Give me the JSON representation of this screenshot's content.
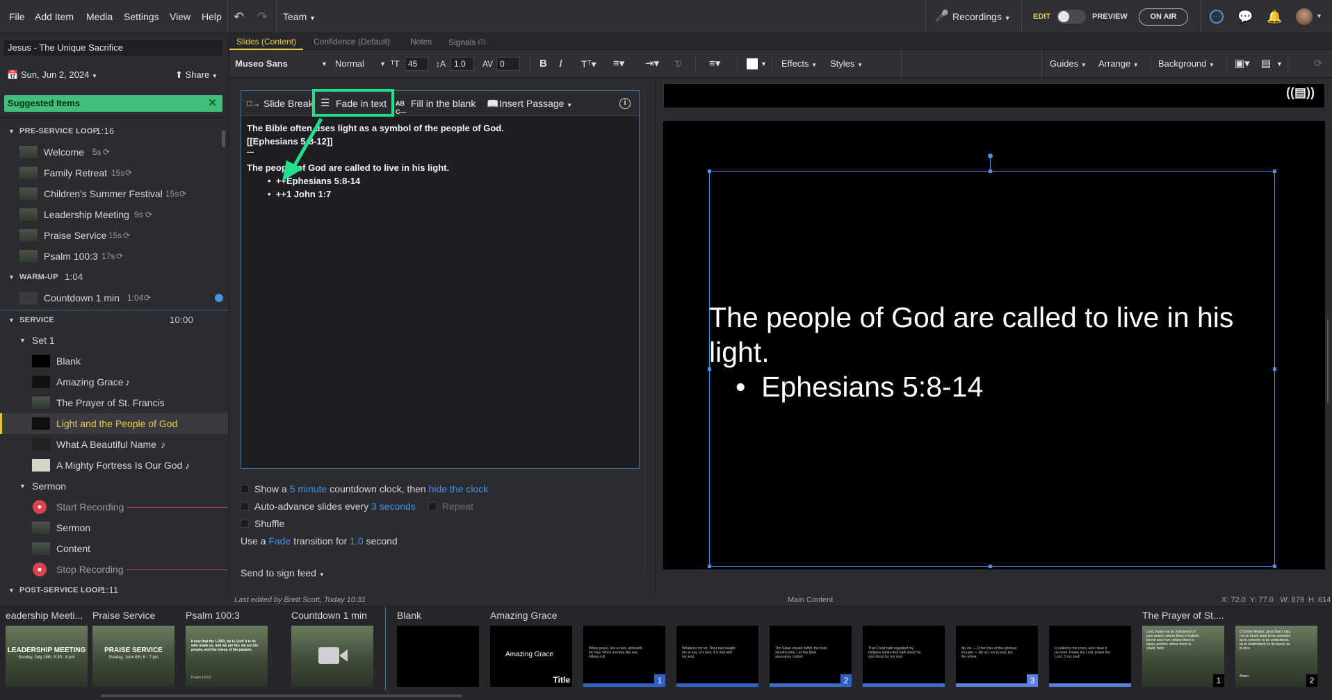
{
  "menubar": {
    "items": [
      "File",
      "Add Item",
      "Media",
      "Settings",
      "View",
      "Help"
    ],
    "team_label": "Team",
    "recordings_label": "Recordings",
    "edit_label": "EDIT",
    "preview_label": "PREVIEW",
    "on_air_label": "ON AIR"
  },
  "plan": {
    "title": "Jesus - The Unique Sacrifice",
    "date": "Sun, Jun 2, 2024",
    "share_label": "Share",
    "suggested_label": "Suggested Items"
  },
  "sidebar": {
    "pre_service": {
      "label": "PRE-SERVICE LOOP",
      "duration": "1:16",
      "items": [
        {
          "name": "Welcome",
          "dur": "5s"
        },
        {
          "name": "Family Retreat",
          "dur": "15s"
        },
        {
          "name": "Children's Summer Festival",
          "dur": "15s"
        },
        {
          "name": "Leadership Meeting",
          "dur": "9s"
        },
        {
          "name": "Praise Service",
          "dur": "15s"
        },
        {
          "name": "Psalm 100:3",
          "dur": "17s"
        }
      ]
    },
    "warm_up": {
      "label": "WARM-UP",
      "duration": "1:04",
      "items": [
        {
          "name": "Countdown 1 min",
          "dur": "1:04"
        }
      ]
    },
    "service": {
      "label": "SERVICE",
      "duration": "10:00"
    },
    "set1": {
      "label": "Set 1",
      "items": [
        "Blank",
        "Amazing Grace",
        "The Prayer of St. Francis",
        "Light and the People of God",
        "What A Beautiful Name",
        "A Mighty Fortress Is Our God"
      ]
    },
    "sermon": {
      "label": "Sermon",
      "items": [
        "Start Recording",
        "Sermon",
        "Content",
        "Stop Recording"
      ]
    },
    "post_service": {
      "label": "POST-SERVICE LOOP",
      "duration": "1:11"
    }
  },
  "tabs": {
    "slides": "Slides (Content)",
    "confidence": "Confidence (Default)",
    "notes": "Notes",
    "signals": "Signals",
    "signals_count": "(7)"
  },
  "toolbar": {
    "font": "Museo Sans",
    "weight": "Normal",
    "size": "45",
    "line_height": "1.0",
    "spacing": "0",
    "effects": "Effects",
    "styles": "Styles",
    "guides": "Guides",
    "arrange": "Arrange",
    "background": "Background"
  },
  "editor": {
    "slide_break": "Slide Break",
    "fade_in_text": "Fade in text",
    "fill_blank": "Fill in the blank",
    "insert_passage": "Insert Passage",
    "lines": [
      "The Bible often uses light as a symbol of the people of God.",
      "[[Ephesians 5:8-12]]",
      "---",
      "The people of God are called to live in his light."
    ],
    "bullets": [
      "++Ephesians 5:8-14",
      "++1 John 1:7"
    ]
  },
  "options": {
    "show_a": "Show a",
    "five_minute": "5 minute",
    "countdown_then": "countdown clock, then",
    "hide_clock": "hide the clock",
    "auto_advance": "Auto-advance slides every",
    "three_seconds": "3 seconds",
    "repeat": "Repeat",
    "shuffle": "Shuffle",
    "use_a": "Use a",
    "fade": "Fade",
    "transition_for": "transition for",
    "one_point_zero": "1.0",
    "second": "second",
    "send_to_sign": "Send to sign feed"
  },
  "preview": {
    "text": "The people of God are called to live in his light.",
    "bullet": "Ephesians 5:8-14"
  },
  "status": {
    "last_edited": "Last edited by Brett Scott, Today 10:31",
    "main_content": "Main Content",
    "coords": "X: 72.0  Y: 77.0   W: 879  H: 614"
  },
  "filmstrip": {
    "labels": [
      "eadership Meeti...",
      "Praise Service",
      "Psalm 100:3",
      "Countdown 1 min",
      "Blank",
      "Amazing Grace",
      "The Prayer of St...."
    ],
    "leadership_thumb": "LEADERSHIP MEETING",
    "leadership_date": "Sunday, July 26th, 5:30 - 8 pm",
    "praise_thumb": "PRAISE SERVICE",
    "praise_date": "Sunday, June 6th, 6 - 7 pm",
    "psalm_thumb": "Know that the LORD, he is God! It is he who made us, and we are his; we are his people, and the sheep of his pasture.",
    "psalm_ref": "Psalm 100:3",
    "amazing_grace_thumb": "Amazing Grace",
    "title_tag": "Title",
    "slide_nums": [
      "1",
      "2",
      "3",
      "1",
      "2"
    ],
    "lyrics": [
      "When peace, like a river, attendeth my way, When sorrows like sea billows roll",
      "Whatever my lot, Thou hast taught me to say, It is well, it is well with my soul.",
      "Tho Satan should buffet, tho trials should come, Let this blest assurance control",
      "That Christ hath regarded my helpless estate And hath shed His own blood for my soul.",
      "My sin — O the bliss of this glorious thought — My sin, not in part, but the whole,",
      "Is nailed to the cross, and I bear it no more, Praise the Lord, praise the Lord, O my soul!"
    ],
    "prayer_text_1": "Lord, make me an instrument of your peace: where there is hatred, let me sow love; where there is injury, pardon; where there is doubt, faith;",
    "prayer_text_2": "O Divine Master, grant that I may not so much seek to be consoled as to console; to be understood, as to understand; to be loved, as to love.",
    "prayer_amen": "Amen"
  }
}
